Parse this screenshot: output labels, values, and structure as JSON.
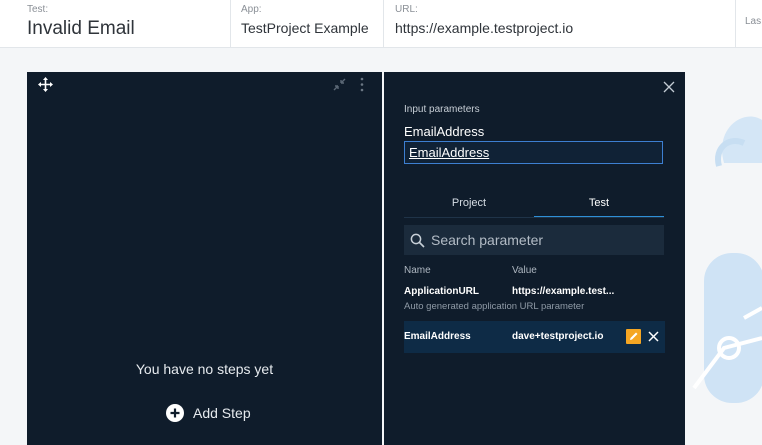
{
  "header": {
    "test_label": "Test:",
    "test_value": "Invalid Email",
    "app_label": "App:",
    "app_value": "TestProject Example",
    "url_label": "URL:",
    "url_value": "https://example.testproject.io",
    "last_label": "Las"
  },
  "steps": {
    "empty_text": "You have no steps yet",
    "add_label": "Add Step"
  },
  "params": {
    "title": "Input parameters",
    "param_name": "EmailAddress",
    "input_value": "EmailAddress",
    "tabs": [
      {
        "label": "Project",
        "active": false
      },
      {
        "label": "Test",
        "active": true
      }
    ],
    "search_placeholder": "Search parameter",
    "columns": {
      "name": "Name",
      "value": "Value"
    },
    "rows": [
      {
        "name": "ApplicationURL",
        "value": "https://example.test...",
        "description": "Auto generated application URL parameter"
      },
      {
        "name": "EmailAddress",
        "value": "dave+testproject.io"
      }
    ]
  },
  "colors": {
    "panel_bg": "#0f1c2b",
    "accent": "#2e8fd6",
    "edit_icon": "#f5a623"
  },
  "icons": [
    "move-icon",
    "collapse-icon",
    "kebab-icon",
    "plus-circle-icon",
    "close-icon",
    "search-icon",
    "edit-icon",
    "delete-icon"
  ]
}
